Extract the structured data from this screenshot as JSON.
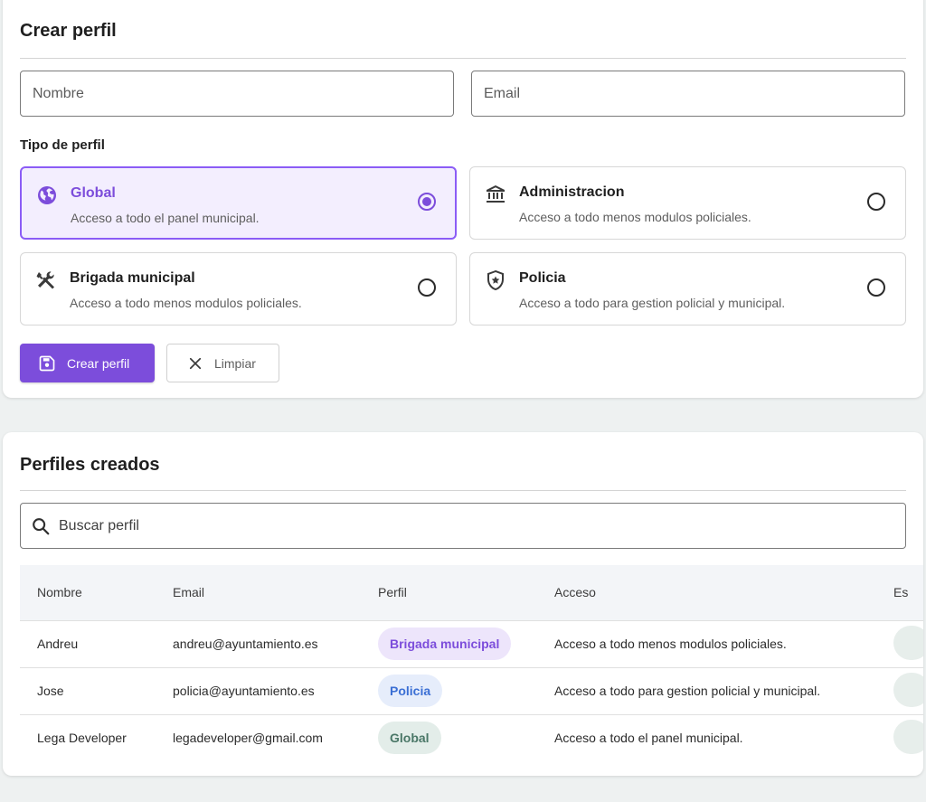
{
  "create": {
    "title": "Crear perfil",
    "name_placeholder": "Nombre",
    "email_placeholder": "Email",
    "type_label": "Tipo de perfil",
    "options": [
      {
        "title": "Global",
        "desc": "Acceso a todo el panel municipal.",
        "icon": "globe-icon",
        "selected": true
      },
      {
        "title": "Administracion",
        "desc": "Acceso a todo menos modulos policiales.",
        "icon": "bank-icon",
        "selected": false
      },
      {
        "title": "Brigada municipal",
        "desc": "Acceso a todo menos modulos policiales.",
        "icon": "tools-icon",
        "selected": false
      },
      {
        "title": "Policia",
        "desc": "Acceso a todo para gestion policial y municipal.",
        "icon": "shield-icon",
        "selected": false
      }
    ],
    "create_button": "Crear perfil",
    "clear_button": "Limpiar"
  },
  "list": {
    "title": "Perfiles creados",
    "search_placeholder": "Buscar perfil",
    "columns": [
      "Nombre",
      "Email",
      "Perfil",
      "Acceso",
      "Es"
    ],
    "rows": [
      {
        "name": "Andreu",
        "email": "andreu@ayuntamiento.es",
        "profile": "Brigada municipal",
        "access": "Acceso a todo menos modulos policiales."
      },
      {
        "name": "Jose",
        "email": "policia@ayuntamiento.es",
        "profile": "Policia",
        "access": "Acceso a todo para gestion policial y municipal."
      },
      {
        "name": "Lega Developer",
        "email": "legadeveloper@gmail.com",
        "profile": "Global",
        "access": "Acceso a todo el panel municipal."
      }
    ]
  },
  "colors": {
    "accent": "#7c4ddb",
    "selected_bg": "#f3eefe",
    "chip_brigada_bg": "#ede5fb",
    "chip_brigada_fg": "#7c4ddb",
    "chip_policia_bg": "#e6edfb",
    "chip_policia_fg": "#3b6fd4",
    "chip_global_bg": "#e3ede9",
    "chip_global_fg": "#4a7767"
  }
}
